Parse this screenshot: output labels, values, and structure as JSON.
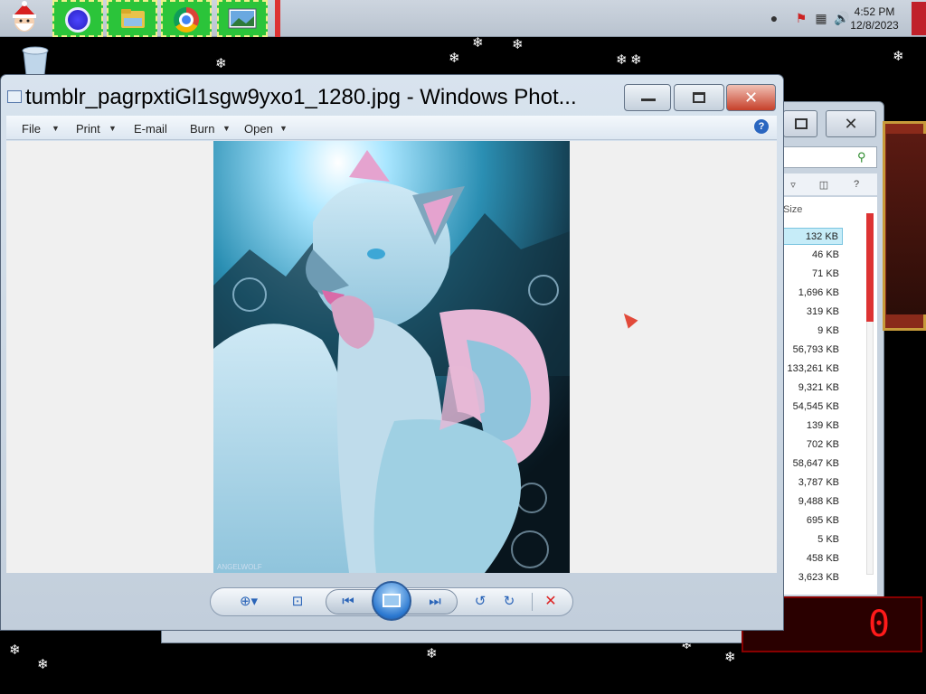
{
  "taskbar": {
    "apps": [
      {
        "name": "santa-start-icon"
      },
      {
        "name": "blue-orb-app",
        "color": "#3a35e0"
      },
      {
        "name": "file-explorer-app"
      },
      {
        "name": "chrome-app"
      },
      {
        "name": "photo-viewer-app"
      }
    ],
    "clock": {
      "time": "4:52 PM",
      "date": "12/8/2023"
    }
  },
  "photo_viewer": {
    "title": "tumblr_pagrpxtiGl1sgw9yxo1_1280.jpg - Windows Phot...",
    "menu": [
      {
        "label": "File",
        "has_dropdown": true
      },
      {
        "label": "Print",
        "has_dropdown": true
      },
      {
        "label": "E-mail",
        "has_dropdown": false
      },
      {
        "label": "Burn",
        "has_dropdown": true
      },
      {
        "label": "Open",
        "has_dropdown": true
      }
    ],
    "help_label": "?",
    "controls": [
      "zoom-icon",
      "actual-size-icon",
      "previous-icon",
      "slideshow-icon",
      "next-icon",
      "rotate-counterclockwise-icon",
      "rotate-clockwise-icon",
      "delete-icon"
    ],
    "delete_glyph": "✕"
  },
  "explorer": {
    "size_header": "Size",
    "sizes": [
      "132 KB",
      "46 KB",
      "71 KB",
      "1,696 KB",
      "319 KB",
      "9 KB",
      "56,793 KB",
      "133,261 KB",
      "9,321 KB",
      "54,545 KB",
      "139 KB",
      "702 KB",
      "58,647 KB",
      "3,787 KB",
      "9,488 KB",
      "695 KB",
      "5 KB",
      "458 KB",
      "3,623 KB"
    ],
    "help_label": "?"
  },
  "colors": {
    "accent": "#2a64b8",
    "taskbar_app_bg": "#2bc43a",
    "desktop": "#000000"
  }
}
